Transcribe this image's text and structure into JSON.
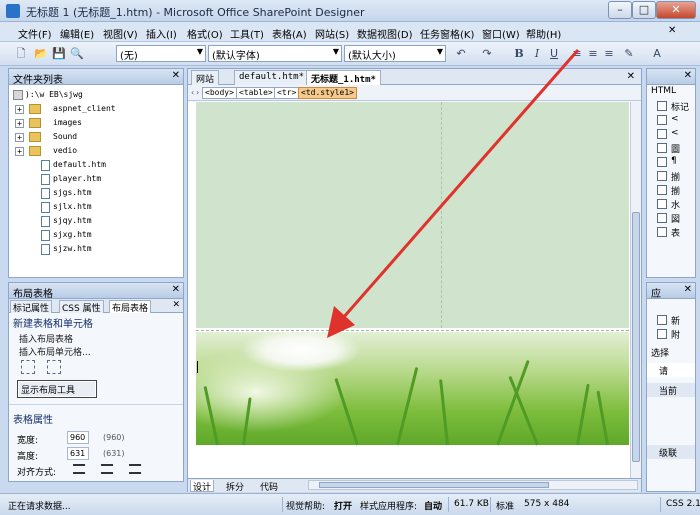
{
  "window": {
    "title": "无标题 1 (无标题_1.htm) - Microsoft Office SharePoint Designer",
    "controls": {
      "minimize": "–",
      "maximize": "□",
      "close": "✕"
    }
  },
  "menu": {
    "items": [
      "文件(F)",
      "编辑(E)",
      "视图(V)",
      "插入(I)",
      "格式(O)",
      "工具(T)",
      "表格(A)",
      "网站(S)",
      "数据视图(D)",
      "任务窗格(K)",
      "窗口(W)",
      "帮助(H)"
    ]
  },
  "toolbar": {
    "style_combo": "(无)",
    "font_combo": "(默认字体)",
    "size_combo": "(默认大小)",
    "bold": "B",
    "italic": "I",
    "underline": "U"
  },
  "folder_panel": {
    "title": "文件夹列表",
    "root": "):\\w   EB\\sjwg",
    "items": [
      {
        "type": "folder",
        "label": "aspnet_client"
      },
      {
        "type": "folder",
        "label": "images"
      },
      {
        "type": "folder",
        "label": "Sound"
      },
      {
        "type": "folder",
        "label": "vedio"
      },
      {
        "type": "file",
        "label": "default.htm"
      },
      {
        "type": "file",
        "label": "player.htm"
      },
      {
        "type": "file",
        "label": "sjgs.htm"
      },
      {
        "type": "file",
        "label": "sjlx.htm"
      },
      {
        "type": "file",
        "label": "sjqy.htm"
      },
      {
        "type": "file",
        "label": "sjxg.htm"
      },
      {
        "type": "file",
        "label": "sjzw.htm"
      }
    ]
  },
  "layout_panel": {
    "title": "布局表格",
    "tabs": [
      "标记属性",
      "CSS 属性",
      "布局表格"
    ],
    "new_section": "新建表格和单元格",
    "insert_table": "插入布局表格",
    "insert_cell": "插入布局单元格...",
    "show_tool": "显示布局工具",
    "props_title": "表格属性",
    "width_label": "宽度:",
    "width_value": "960",
    "width_paren": "(960)",
    "height_label": "高度:",
    "height_value": "631",
    "height_paren": "(631)",
    "align_label": "对齐方式:"
  },
  "editor": {
    "tabs": [
      "网站",
      "default.htm*",
      "无标题_1.htm*"
    ],
    "crumbs": [
      "<body>",
      "<table>",
      "<tr>",
      "<td.style1>"
    ],
    "view_tabs": [
      "设计",
      "拆分",
      "代码"
    ]
  },
  "right_top": {
    "title": "HTML",
    "items": [
      "标记",
      "<",
      "<",
      "圖",
      "¶",
      "揃",
      "揃",
      "水",
      "図",
      "表"
    ]
  },
  "right_bot": {
    "items": [
      "应",
      "新",
      "附",
      "选择",
      "请",
      "当前",
      "级联"
    ]
  },
  "status": {
    "left": "正在请求数据...",
    "visual_aid_label": "视觉帮助:",
    "visual_aid_value": "打开",
    "style_app_label": "样式应用程序:",
    "style_app_value": "自动",
    "size": "61.7 KB",
    "mode": "标准",
    "dims": "575 x 484",
    "css": "CSS 2.1"
  },
  "colors": {
    "page_green": "#cfe3cd",
    "arrow": "#e0322c",
    "active_crumb": "#f6c98c"
  }
}
